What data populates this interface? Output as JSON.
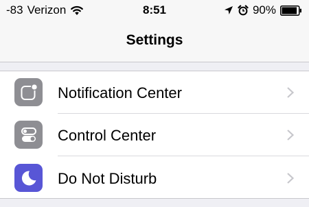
{
  "status_bar": {
    "signal": "-83",
    "carrier": "Verizon",
    "time": "8:51",
    "battery_percent": "90%",
    "battery_level": 0.9,
    "icons": [
      "wifi-icon",
      "location-arrow-icon",
      "alarm-clock-icon",
      "battery-icon"
    ]
  },
  "nav": {
    "title": "Settings"
  },
  "settings": {
    "items": [
      {
        "label": "Notification Center",
        "icon": "notification-center-icon",
        "icon_color": "#8e8e93"
      },
      {
        "label": "Control Center",
        "icon": "control-center-icon",
        "icon_color": "#8e8e93"
      },
      {
        "label": "Do Not Disturb",
        "icon": "moon-icon",
        "icon_color": "#5856d6"
      }
    ]
  },
  "colors": {
    "bar_background": "#f7f7f7",
    "group_background": "#efeff4",
    "separator": "#c8c7cc",
    "chevron": "#c7c7cc"
  }
}
